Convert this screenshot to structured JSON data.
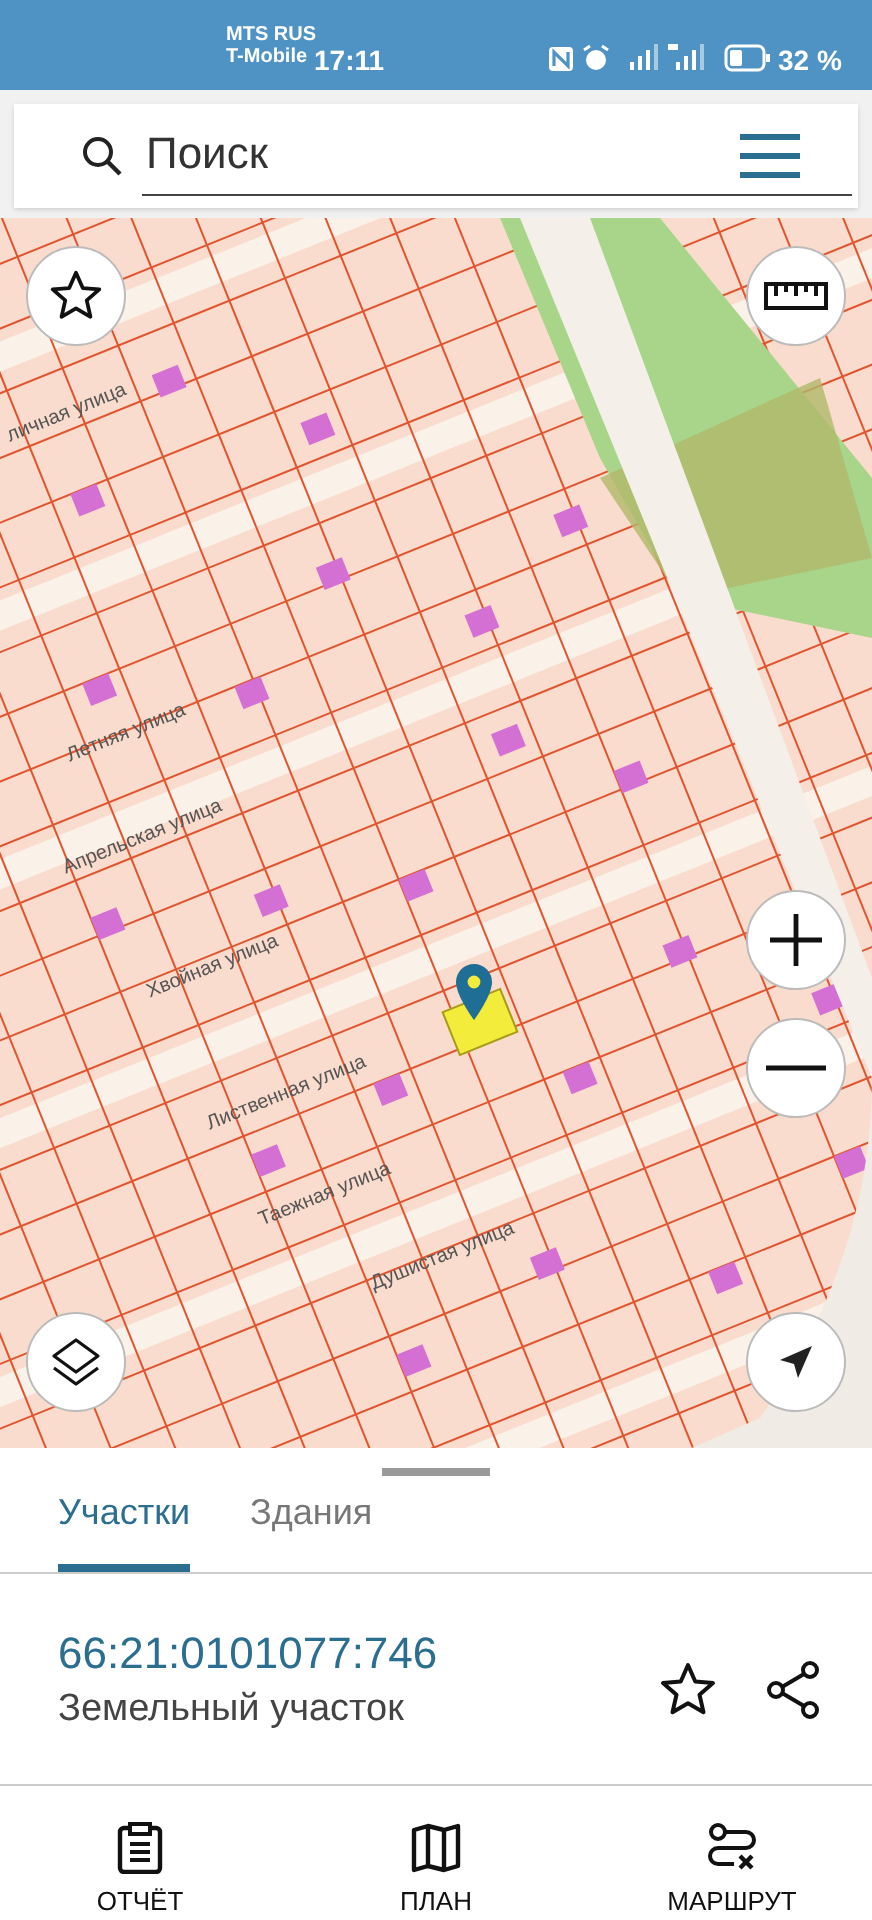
{
  "status_bar": {
    "carrier_1": "MTS RUS",
    "carrier_2": "T-Mobile",
    "time": "17:11",
    "battery": "32 %"
  },
  "search": {
    "placeholder": "Поиск"
  },
  "map": {
    "street_labels": [
      {
        "text": "личная улица"
      },
      {
        "text": "Летняя улица"
      },
      {
        "text": "Апрельская улица"
      },
      {
        "text": "Хвойная улица"
      },
      {
        "text": "Лиственная улица"
      },
      {
        "text": "Таежная улица"
      },
      {
        "text": "Душистая улица"
      }
    ]
  },
  "tabs": [
    {
      "label": "Участки",
      "selected": true
    },
    {
      "label": "Здания",
      "selected": false
    }
  ],
  "parcel": {
    "number": "66:21:0101077:746",
    "type": "Земельный участок"
  },
  "bottom_nav": [
    {
      "label": "ОТЧЁТ",
      "kind": "report"
    },
    {
      "label": "ПЛАН",
      "kind": "plan"
    },
    {
      "label": "МАРШРУТ",
      "kind": "route"
    }
  ]
}
